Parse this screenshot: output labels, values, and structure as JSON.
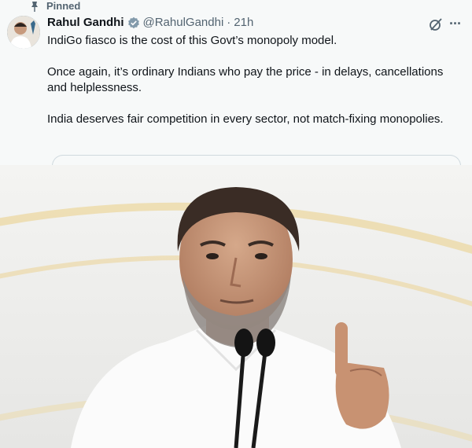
{
  "pinned_label": "Pinned",
  "author": {
    "name": "Rahul Gandhi",
    "handle": "@RahulGandhi",
    "separator": "·",
    "time": "21h",
    "verified_color": "#829aab"
  },
  "tweet": {
    "paragraphs": [
      "IndiGo fiasco is the cost of this Govt’s monopoly model.",
      "Once again, it’s ordinary Indians who pay the price - in delays, cancellations and helplessness.",
      "India deserves fair competition in every sector, not match-fixing monopolies."
    ]
  },
  "icons": {
    "pin": "pin-icon",
    "verified": "verified-badge-icon",
    "grok": "grok-icon",
    "more": "more-icon"
  },
  "colors": {
    "background": "#f7f9f9",
    "text": "#0f1419",
    "secondary": "#536471"
  }
}
